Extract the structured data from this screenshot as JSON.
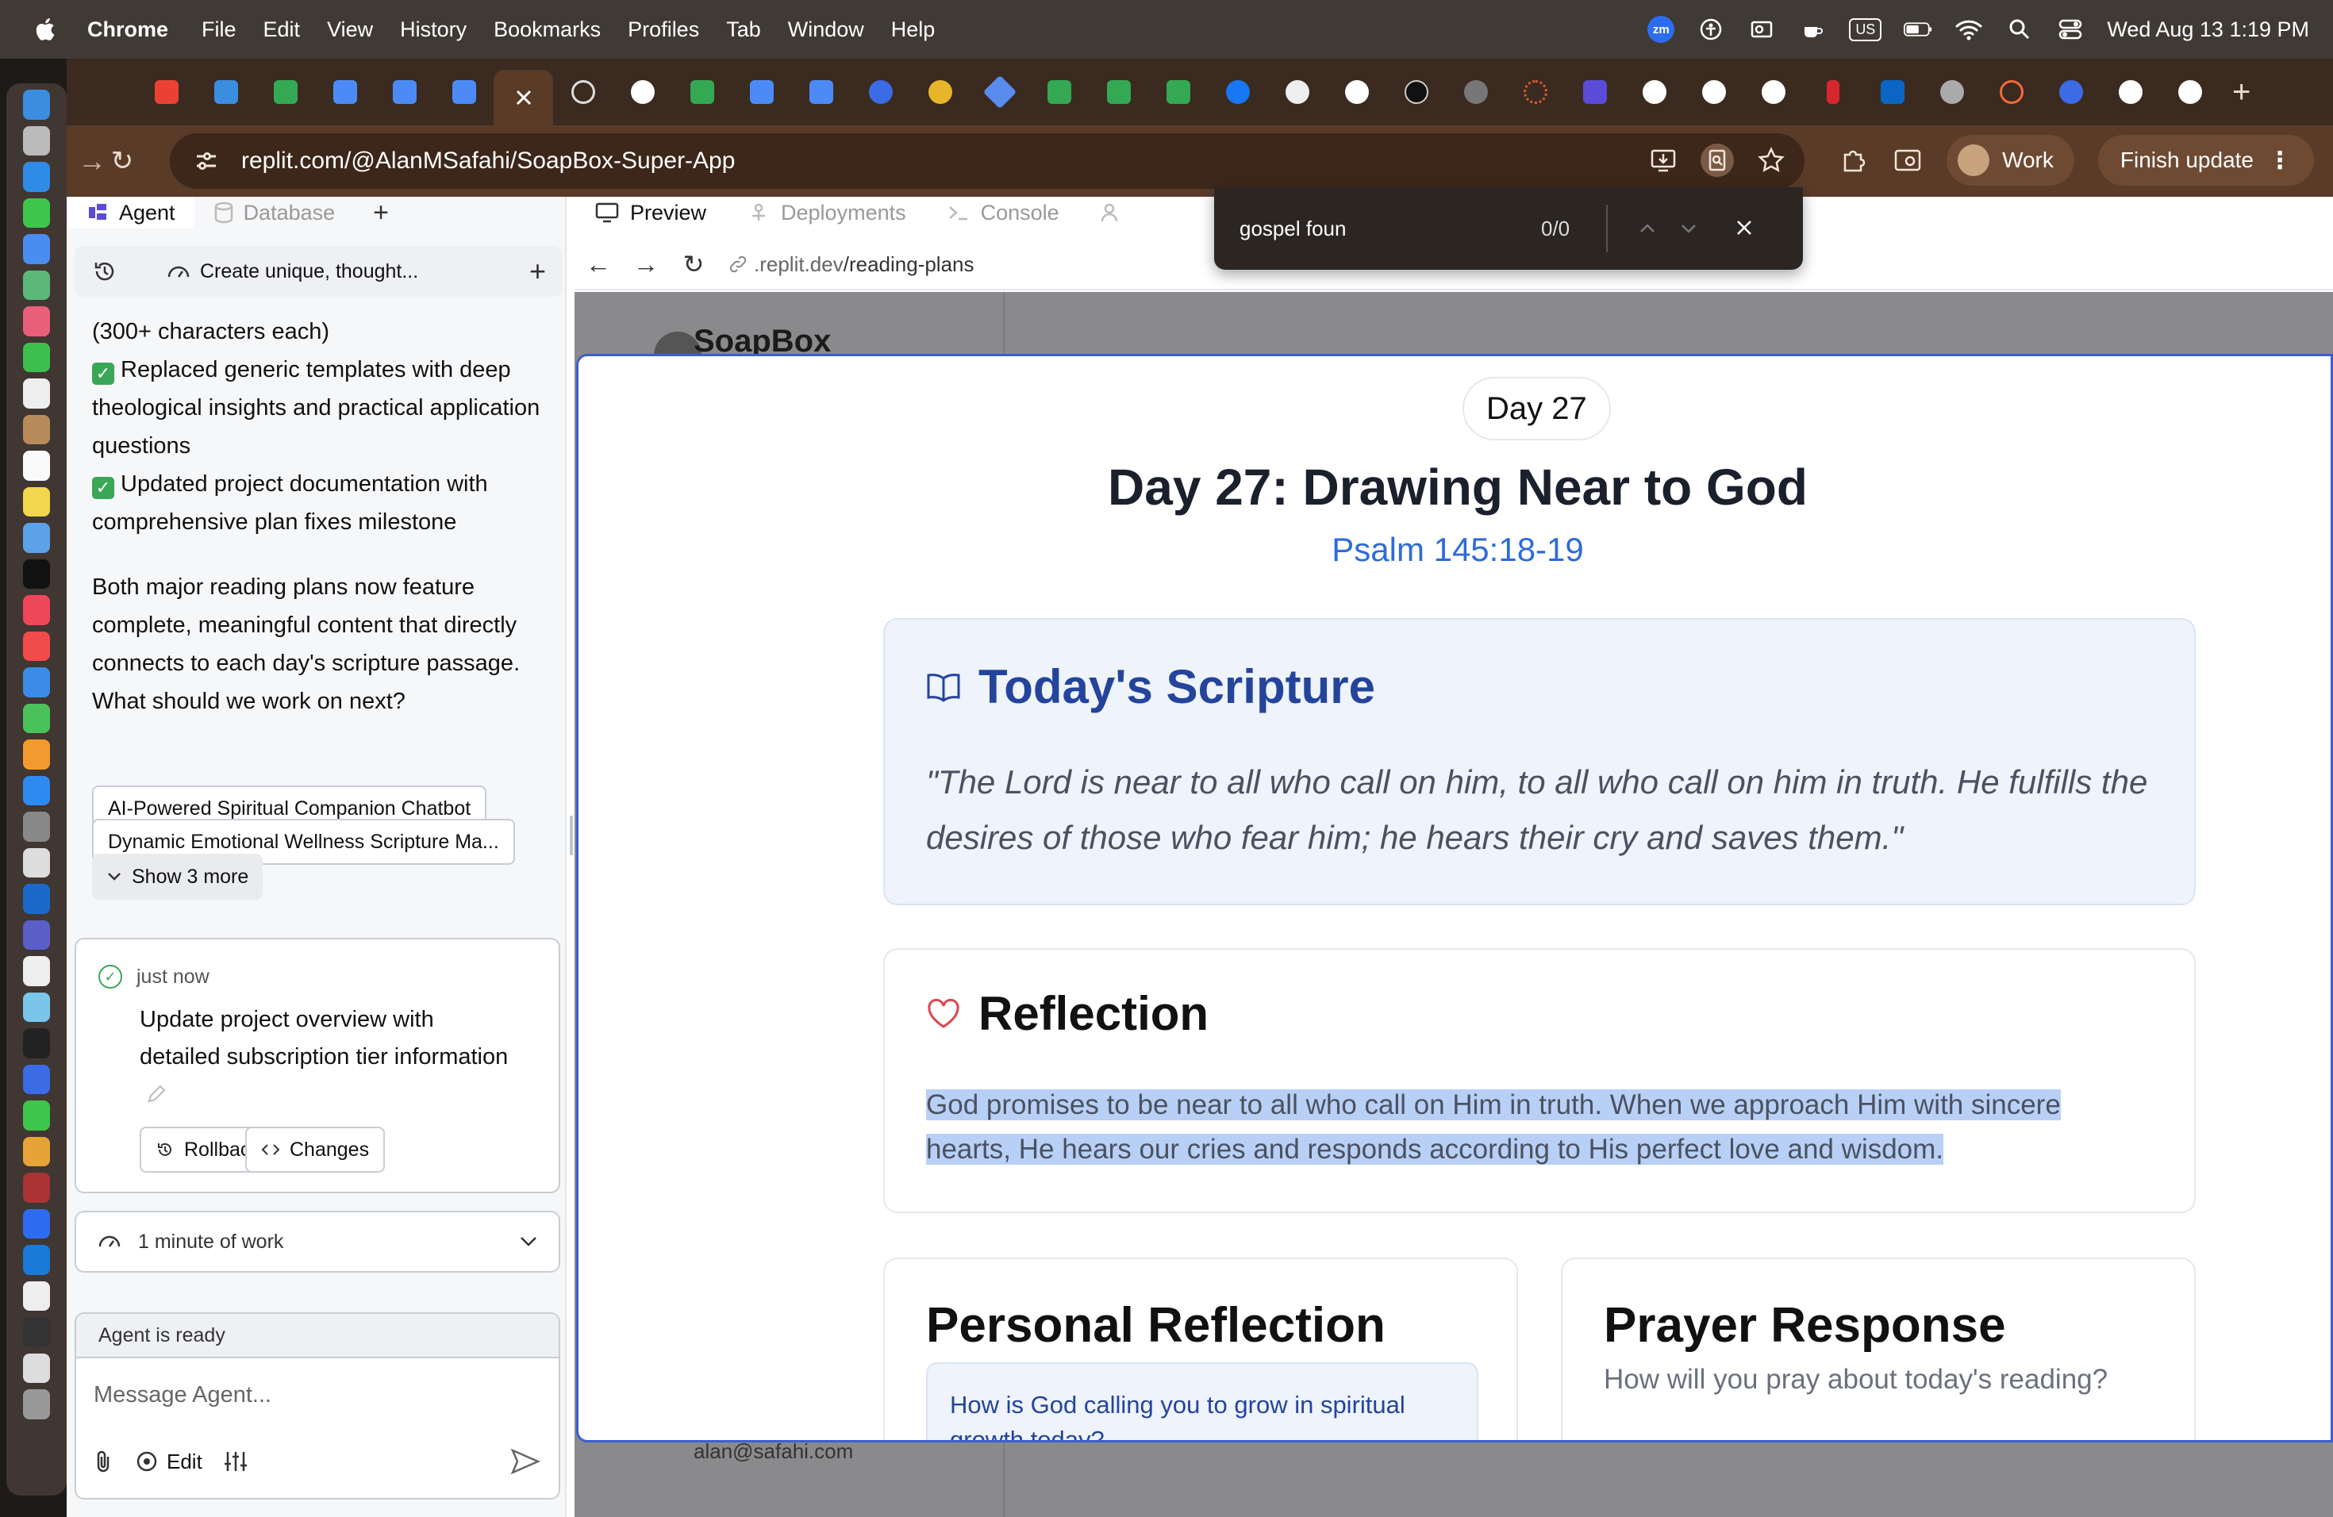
{
  "menubar": {
    "app": "Chrome",
    "menus": [
      "File",
      "Edit",
      "View",
      "History",
      "Bookmarks",
      "Profiles",
      "Tab",
      "Window",
      "Help"
    ],
    "zoom_badge": "zm",
    "input_source": "US",
    "datetime": "Wed Aug 13  1:19 PM"
  },
  "browser": {
    "url": "replit.com/@AlanMSafahi/SoapBox-Super-App",
    "profile": "Work",
    "finish_update": "Finish update",
    "new_tab": "+"
  },
  "find": {
    "query": "gospel foun",
    "count": "0/0"
  },
  "left_panel": {
    "tabs": [
      "Agent",
      "Database"
    ],
    "thread_title": "Create unique, thought...",
    "chat_lines": [
      "(300+ characters each)",
      "Replaced generic templates with deep theological insights and practical application questions",
      "Updated project documentation with comprehensive plan fixes milestone"
    ],
    "chat_paragraph": "Both major reading plans now feature complete, meaningful content that directly connects to each day's scripture passage. What should we work on next?",
    "suggestions": [
      "AI-Powered Spiritual Companion Chatbot",
      "Dynamic Emotional Wellness Scripture Ma..."
    ],
    "show_more": "Show 3 more",
    "checkpoint": {
      "time": "just now",
      "message": "Update project overview with detailed subscription tier information",
      "rollback": "Rollback here",
      "changes": "Changes"
    },
    "work_summary": "1 minute of work",
    "agent_status": "Agent is ready",
    "composer_placeholder": "Message Agent...",
    "edit_label": "Edit"
  },
  "workspace": {
    "tabs": [
      "Preview",
      "Deployments",
      "Console"
    ],
    "preview_host": ".replit.dev",
    "preview_path": "/reading-plans",
    "bg_logo": "SoapBox",
    "bg_footer_email": "alan@safahi.com"
  },
  "modal": {
    "day_badge": "Day 27",
    "title": "Day 27: Drawing Near to God",
    "reference": "Psalm 145:18-19",
    "scripture_heading": "Today's Scripture",
    "scripture_text": "\"The Lord is near to all who call on him, to all who call on him in truth. He fulfills the desires of those who fear him; he hears their cry and saves them.\"",
    "reflection_heading": "Reflection",
    "reflection_text": "God promises to be near to all who call on Him in truth. When we approach Him with sincere hearts, He hears our cries and responds according to His perfect love and wisdom.",
    "personal_heading": "Personal Reflection",
    "personal_prompt": "How is God calling you to grow in spiritual growth today?",
    "prayer_heading": "Prayer Response",
    "prayer_prompt": "How will you pray about today's reading?"
  }
}
